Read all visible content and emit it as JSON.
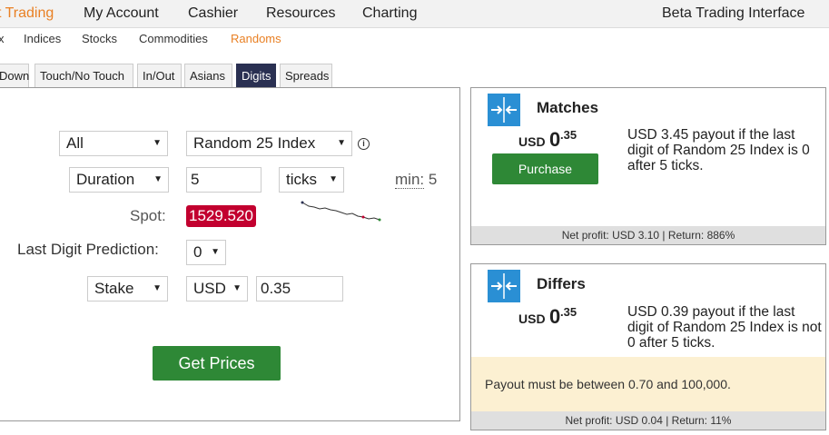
{
  "top_nav": {
    "items": [
      "t Trading",
      "My Account",
      "Cashier",
      "Resources",
      "Charting"
    ],
    "right_label": "Beta Trading Interface"
  },
  "sub_nav": {
    "items": [
      "x",
      "Indices",
      "Stocks",
      "Commodities",
      "Randoms"
    ]
  },
  "tabs": [
    "Down",
    "Touch/No Touch",
    "In/Out",
    "Asians",
    "Digits",
    "Spreads"
  ],
  "form": {
    "market_select": "All",
    "underlying_select": "Random 25 Index",
    "duration_type": "Duration",
    "duration_value": "5",
    "duration_unit": "ticks",
    "min_label": "min:",
    "min_value": "5",
    "spot_label": "Spot:",
    "spot_value": "1529.520",
    "last_digit_label": "Last Digit Prediction:",
    "last_digit_value": "0",
    "amount_type": "Stake",
    "currency": "USD",
    "amount_value": "0.35",
    "get_prices_label": "Get Prices"
  },
  "cards": {
    "matches": {
      "title": "Matches",
      "currency": "USD",
      "amount_int": "0",
      "amount_dec": ".35",
      "description": "USD 3.45 payout if the last digit of Random 25 Index is 0 after 5 ticks.",
      "purchase_label": "Purchase",
      "footer": "Net profit: USD 3.10 | Return: 886%"
    },
    "differs": {
      "title": "Differs",
      "currency": "USD",
      "amount_int": "0",
      "amount_dec": ".35",
      "description": "USD 0.39 payout if the last digit of Random 25 Index is not 0 after 5 ticks.",
      "warning": "Payout must be between 0.70 and 100,000.",
      "footer": "Net profit: USD 0.04 | Return: 11%"
    }
  },
  "colors": {
    "accent_orange": "#e98024",
    "tab_active": "#2a3052",
    "button_green": "#2e8836",
    "spot_red": "#c2002f",
    "icon_blue": "#2a8fd4",
    "warning_bg": "#fcf0d2"
  },
  "icons": {
    "info": "info-circle-icon",
    "contract": "arrows-inward-icon",
    "dropdown": "caret-down-icon"
  }
}
